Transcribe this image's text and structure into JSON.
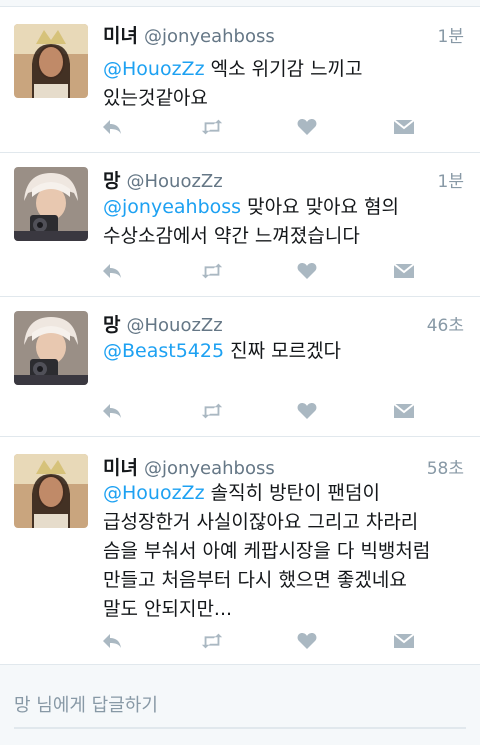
{
  "tweets": [
    {
      "name": "미녀",
      "handle": "@jonyeahboss",
      "time": "1분",
      "mention": "@HouozZz",
      "lines": [
        " 엑소 위기감 느끼고",
        "있는것같아요"
      ]
    },
    {
      "name": "망",
      "handle": "@HouozZz",
      "time": "1분",
      "mention": "@jonyeahboss",
      "lines": [
        " 맞아요 맞아요 혐의",
        "수상소감에서 약간 느껴졌습니다"
      ]
    },
    {
      "name": "망",
      "handle": "@HouozZz",
      "time": "46초",
      "mention": "@Beast5425",
      "lines": [
        " 진짜 모르겠다"
      ]
    },
    {
      "name": "미녀",
      "handle": "@jonyeahboss",
      "time": "58초",
      "mention": "@HouozZz",
      "lines": [
        " 솔직히 방탄이 팬덤이",
        "급성장한거 사실이잖아요 그리고 차라리",
        "슴을 부숴서 아예 케팝시장을 다 빅뱅처럼",
        "만들고 처음부터 다시 했으면 좋겠네요",
        "말도 안되지만..."
      ]
    }
  ],
  "reply": {
    "placeholder": "망 님에게 답글하기"
  },
  "icons": {
    "reply": "reply-icon",
    "retweet": "retweet-icon",
    "like": "heart-icon",
    "dm": "envelope-icon"
  },
  "colors": {
    "mention": "#1da1f2",
    "icon": "#aab8c2",
    "muted": "#8899a6"
  }
}
